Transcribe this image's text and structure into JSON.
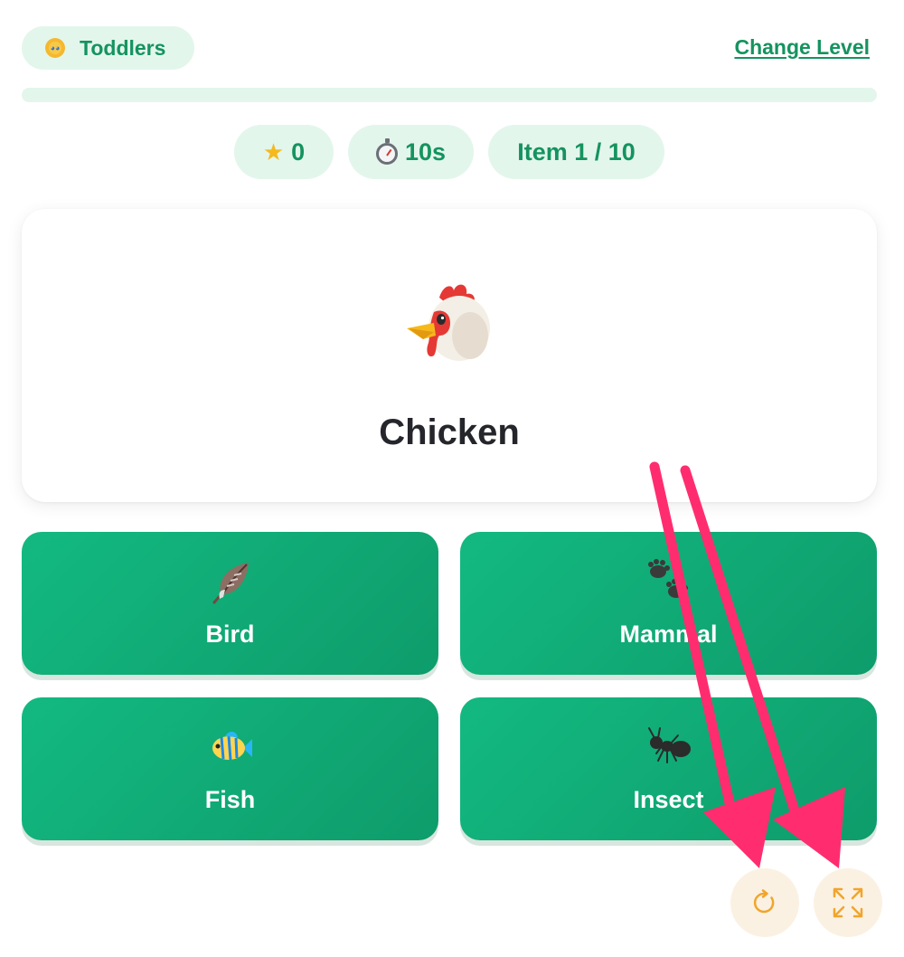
{
  "header": {
    "level_label": "Toddlers",
    "level_icon": "baby-face-icon",
    "change_level_label": "Change Level"
  },
  "progress": {
    "fraction": 0.0
  },
  "stats": {
    "score_icon": "star-icon",
    "score": "0",
    "timer_icon": "stopwatch-icon",
    "timer": "10s",
    "item": "Item 1 / 10"
  },
  "card": {
    "emoji": "chicken-icon",
    "word": "Chicken"
  },
  "answers": [
    {
      "label": "Bird",
      "icon": "feather-icon"
    },
    {
      "label": "Mammal",
      "icon": "paw-prints-icon"
    },
    {
      "label": "Fish",
      "icon": "tropical-fish-icon"
    },
    {
      "label": "Insect",
      "icon": "ant-icon"
    }
  ],
  "controls": {
    "restart_icon": "restart-icon",
    "fullscreen_icon": "fullscreen-icon"
  },
  "colors": {
    "accent": "#15935f",
    "pill_bg": "#e3f6ec",
    "answer_bg": "#13b981",
    "control_bg": "#fbf1e2",
    "control_icon": "#f0a52d",
    "annotation_arrow": "#ff2d6f"
  }
}
